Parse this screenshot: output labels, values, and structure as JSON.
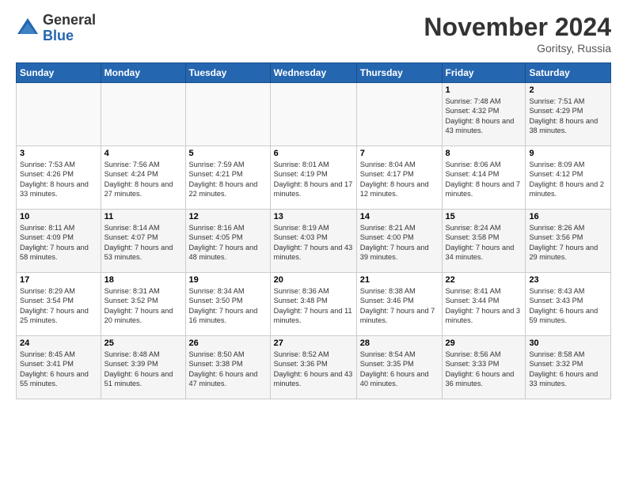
{
  "logo": {
    "general": "General",
    "blue": "Blue"
  },
  "title": "November 2024",
  "location": "Goritsy, Russia",
  "days_header": [
    "Sunday",
    "Monday",
    "Tuesday",
    "Wednesday",
    "Thursday",
    "Friday",
    "Saturday"
  ],
  "weeks": [
    [
      {
        "num": "",
        "info": ""
      },
      {
        "num": "",
        "info": ""
      },
      {
        "num": "",
        "info": ""
      },
      {
        "num": "",
        "info": ""
      },
      {
        "num": "",
        "info": ""
      },
      {
        "num": "1",
        "info": "Sunrise: 7:48 AM\nSunset: 4:32 PM\nDaylight: 8 hours and 43 minutes."
      },
      {
        "num": "2",
        "info": "Sunrise: 7:51 AM\nSunset: 4:29 PM\nDaylight: 8 hours and 38 minutes."
      }
    ],
    [
      {
        "num": "3",
        "info": "Sunrise: 7:53 AM\nSunset: 4:26 PM\nDaylight: 8 hours and 33 minutes."
      },
      {
        "num": "4",
        "info": "Sunrise: 7:56 AM\nSunset: 4:24 PM\nDaylight: 8 hours and 27 minutes."
      },
      {
        "num": "5",
        "info": "Sunrise: 7:59 AM\nSunset: 4:21 PM\nDaylight: 8 hours and 22 minutes."
      },
      {
        "num": "6",
        "info": "Sunrise: 8:01 AM\nSunset: 4:19 PM\nDaylight: 8 hours and 17 minutes."
      },
      {
        "num": "7",
        "info": "Sunrise: 8:04 AM\nSunset: 4:17 PM\nDaylight: 8 hours and 12 minutes."
      },
      {
        "num": "8",
        "info": "Sunrise: 8:06 AM\nSunset: 4:14 PM\nDaylight: 8 hours and 7 minutes."
      },
      {
        "num": "9",
        "info": "Sunrise: 8:09 AM\nSunset: 4:12 PM\nDaylight: 8 hours and 2 minutes."
      }
    ],
    [
      {
        "num": "10",
        "info": "Sunrise: 8:11 AM\nSunset: 4:09 PM\nDaylight: 7 hours and 58 minutes."
      },
      {
        "num": "11",
        "info": "Sunrise: 8:14 AM\nSunset: 4:07 PM\nDaylight: 7 hours and 53 minutes."
      },
      {
        "num": "12",
        "info": "Sunrise: 8:16 AM\nSunset: 4:05 PM\nDaylight: 7 hours and 48 minutes."
      },
      {
        "num": "13",
        "info": "Sunrise: 8:19 AM\nSunset: 4:03 PM\nDaylight: 7 hours and 43 minutes."
      },
      {
        "num": "14",
        "info": "Sunrise: 8:21 AM\nSunset: 4:00 PM\nDaylight: 7 hours and 39 minutes."
      },
      {
        "num": "15",
        "info": "Sunrise: 8:24 AM\nSunset: 3:58 PM\nDaylight: 7 hours and 34 minutes."
      },
      {
        "num": "16",
        "info": "Sunrise: 8:26 AM\nSunset: 3:56 PM\nDaylight: 7 hours and 29 minutes."
      }
    ],
    [
      {
        "num": "17",
        "info": "Sunrise: 8:29 AM\nSunset: 3:54 PM\nDaylight: 7 hours and 25 minutes."
      },
      {
        "num": "18",
        "info": "Sunrise: 8:31 AM\nSunset: 3:52 PM\nDaylight: 7 hours and 20 minutes."
      },
      {
        "num": "19",
        "info": "Sunrise: 8:34 AM\nSunset: 3:50 PM\nDaylight: 7 hours and 16 minutes."
      },
      {
        "num": "20",
        "info": "Sunrise: 8:36 AM\nSunset: 3:48 PM\nDaylight: 7 hours and 11 minutes."
      },
      {
        "num": "21",
        "info": "Sunrise: 8:38 AM\nSunset: 3:46 PM\nDaylight: 7 hours and 7 minutes."
      },
      {
        "num": "22",
        "info": "Sunrise: 8:41 AM\nSunset: 3:44 PM\nDaylight: 7 hours and 3 minutes."
      },
      {
        "num": "23",
        "info": "Sunrise: 8:43 AM\nSunset: 3:43 PM\nDaylight: 6 hours and 59 minutes."
      }
    ],
    [
      {
        "num": "24",
        "info": "Sunrise: 8:45 AM\nSunset: 3:41 PM\nDaylight: 6 hours and 55 minutes."
      },
      {
        "num": "25",
        "info": "Sunrise: 8:48 AM\nSunset: 3:39 PM\nDaylight: 6 hours and 51 minutes."
      },
      {
        "num": "26",
        "info": "Sunrise: 8:50 AM\nSunset: 3:38 PM\nDaylight: 6 hours and 47 minutes."
      },
      {
        "num": "27",
        "info": "Sunrise: 8:52 AM\nSunset: 3:36 PM\nDaylight: 6 hours and 43 minutes."
      },
      {
        "num": "28",
        "info": "Sunrise: 8:54 AM\nSunset: 3:35 PM\nDaylight: 6 hours and 40 minutes."
      },
      {
        "num": "29",
        "info": "Sunrise: 8:56 AM\nSunset: 3:33 PM\nDaylight: 6 hours and 36 minutes."
      },
      {
        "num": "30",
        "info": "Sunrise: 8:58 AM\nSunset: 3:32 PM\nDaylight: 6 hours and 33 minutes."
      }
    ]
  ]
}
